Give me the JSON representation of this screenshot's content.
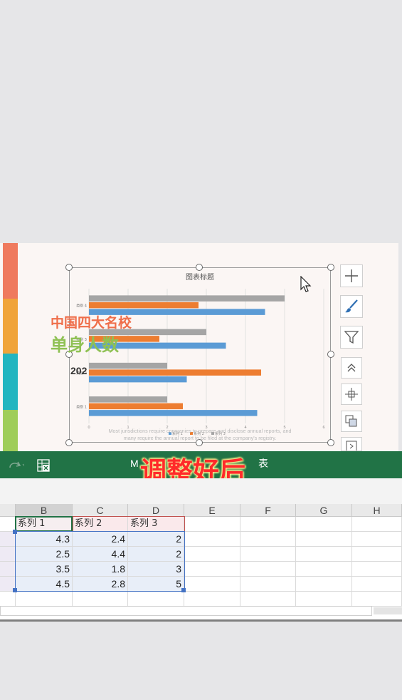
{
  "slide": {
    "color_strips": [
      "#ef7a5e",
      "#f0a43a",
      "#22b5c0",
      "#9fcd5a"
    ],
    "overlay": {
      "line1": "中国四大名校",
      "line2": "单身人数",
      "line3": "202"
    },
    "caption_line1": "Most jurisdictions require companies to prepare and disclose annual reports, and",
    "caption_line2": "many require the annual report to be filed at the company's registry.",
    "side_buttons": [
      "plus-icon",
      "brush-icon",
      "filter-icon",
      "chevron-up-icon",
      "crop-icon",
      "layers-icon",
      "next-icon"
    ]
  },
  "chart_data": {
    "type": "bar",
    "orientation": "horizontal",
    "title": "图表标题",
    "categories": [
      "类别 1",
      "类别 2",
      "类别 3",
      "类别 4"
    ],
    "series": [
      {
        "name": "系列 1",
        "color": "#5b9bd5",
        "values": [
          4.3,
          2.5,
          3.5,
          4.5
        ]
      },
      {
        "name": "系列 2",
        "color": "#ed7d31",
        "values": [
          2.4,
          4.4,
          1.8,
          2.8
        ]
      },
      {
        "name": "系列 3",
        "color": "#a5a5a5",
        "values": [
          2,
          2,
          3,
          5
        ]
      }
    ],
    "xlim": [
      0,
      6
    ],
    "xticks": [
      "0",
      "1",
      "2",
      "3",
      "4",
      "5",
      "6"
    ],
    "grid": true,
    "legend": "bottom"
  },
  "excel": {
    "ribbon_title_left": "M",
    "ribbon_title_right": "表",
    "banner": "调整好后",
    "columns": [
      "B",
      "C",
      "D",
      "E",
      "F",
      "G",
      "H"
    ],
    "header_row": [
      "系列 1",
      "系列 2",
      "系列 3"
    ],
    "rows": [
      [
        "4.3",
        "2.4",
        "2"
      ],
      [
        "2.5",
        "4.4",
        "2"
      ],
      [
        "3.5",
        "1.8",
        "3"
      ],
      [
        "4.5",
        "2.8",
        "5"
      ]
    ]
  }
}
